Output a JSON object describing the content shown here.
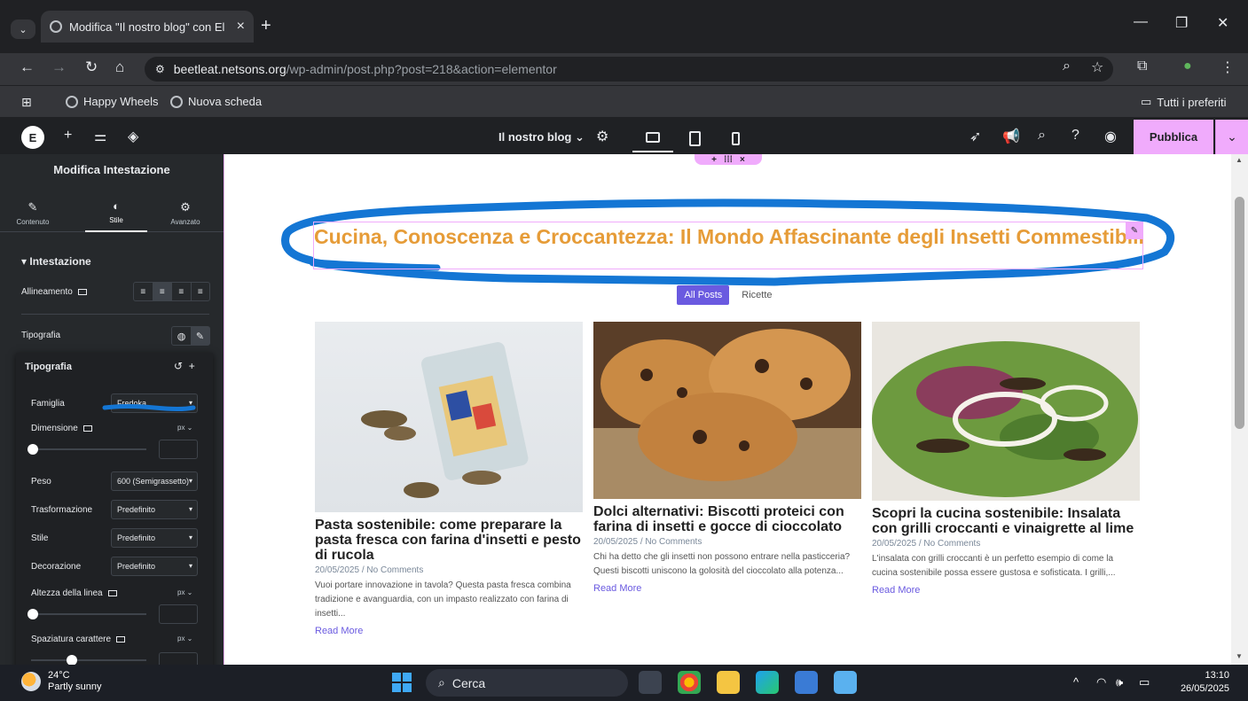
{
  "browser": {
    "tab_title": "Modifica \"Il nostro blog\" con El",
    "url_host": "beetleat.netsons.org",
    "url_path": "/wp-admin/post.php?post=218&action=elementor",
    "bookmarks": [
      "Happy Wheels",
      "Nuova scheda"
    ],
    "all_bookmarks": "Tutti i preferiti"
  },
  "editor": {
    "document_title": "Il nostro blog",
    "publish_label": "Pubblica"
  },
  "panel": {
    "title": "Modifica Intestazione",
    "tabs": [
      "Contenuto",
      "Stile",
      "Avanzato"
    ],
    "section": "Intestazione",
    "alignment_label": "Allineamento",
    "typography_label": "Tipografia",
    "popover": {
      "title": "Tipografia",
      "family_label": "Famiglia",
      "family_value": "Fredoka",
      "size_label": "Dimensione",
      "size_unit": "px",
      "weight_label": "Peso",
      "weight_value": "600 (Semigrassetto)",
      "transform_label": "Trasformazione",
      "transform_value": "Predefinito",
      "style_label": "Stile",
      "style_value": "Predefinito",
      "decoration_label": "Decorazione",
      "decoration_value": "Predefinito",
      "line_height_label": "Altezza della linea",
      "line_height_unit": "px",
      "letter_spacing_label": "Spaziatura carattere",
      "letter_spacing_unit": "px"
    }
  },
  "page": {
    "heading": "Cucina, Conoscenza e Croccantezza: Il Mondo Affascinante degli Insetti Commestibili",
    "filters": [
      "All Posts",
      "Ricette"
    ],
    "posts": [
      {
        "title": "Pasta sostenibile: come preparare la pasta fresca con farina d'insetti e pesto di rucola",
        "date": "20/05/2025",
        "comments": "No Comments",
        "excerpt": "Vuoi portare innovazione in tavola? Questa pasta fresca combina tradizione e avanguardia, con un impasto realizzato con farina di insetti...",
        "read_more": "Read More"
      },
      {
        "title": "Dolci alternativi: Biscotti proteici con farina di insetti e gocce di cioccolato",
        "date": "20/05/2025",
        "comments": "No Comments",
        "excerpt": "Chi ha detto che gli insetti non possono entrare nella pasticceria? Questi biscotti uniscono la golosità del cioccolato alla potenza...",
        "read_more": "Read More"
      },
      {
        "title": "Scopri la cucina sostenibile: Insalata con grilli croccanti e vinaigrette al lime",
        "date": "20/05/2025",
        "comments": "No Comments",
        "excerpt": "L'insalata con grilli croccanti è un perfetto esempio di come la cucina sostenibile possa essere gustosa e sofisticata. I grilli,...",
        "read_more": "Read More"
      }
    ]
  },
  "taskbar": {
    "temperature": "24°C",
    "weather": "Partly sunny",
    "search": "Cerca",
    "time": "13:10",
    "date": "26/05/2025"
  },
  "colors": {
    "accent": "#f0abfc",
    "heading": "#e69c38",
    "filter_active": "#6a5ae0",
    "scribble": "#1476d4"
  }
}
